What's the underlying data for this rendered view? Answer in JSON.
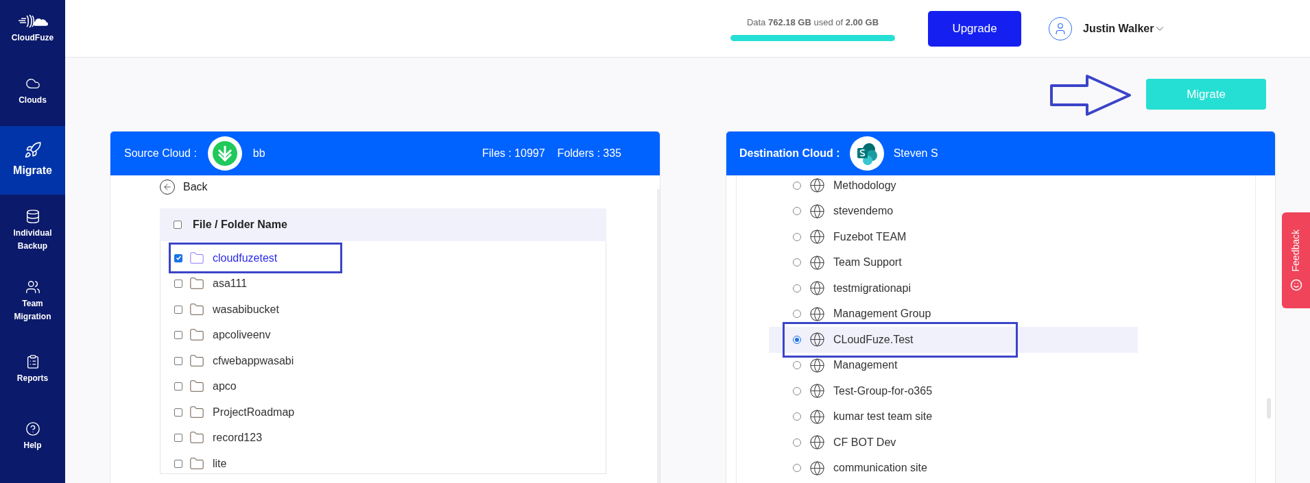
{
  "sidebar": {
    "brand": "CloudFuze",
    "items": [
      {
        "label": "Clouds",
        "selected": false
      },
      {
        "label": "Migrate",
        "selected": true
      },
      {
        "label": "Individual Backup",
        "selected": false
      },
      {
        "label": "Team Migration",
        "selected": false
      },
      {
        "label": "Reports",
        "selected": false
      },
      {
        "label": "Help",
        "selected": false
      }
    ]
  },
  "top_bar": {
    "storage": {
      "text": "Data **762.18 GB** used of **2.00 GB**",
      "level": 1
    },
    "upgrade_button": "Upgrade",
    "user": "Justin Walker"
  },
  "migrate_button": "Migrate",
  "source": {
    "label": "Source Cloud :",
    "account": "bb",
    "files": "Files : 10997",
    "folders": "Folders : 335",
    "back": "Back",
    "column": "File / Folder Name",
    "all_checked": false,
    "rows": [
      {
        "name": "cloudfuzetest",
        "checked": true
      },
      {
        "name": "asa111",
        "checked": false
      },
      {
        "name": "wasabibucket",
        "checked": false
      },
      {
        "name": "apcoliveenv",
        "checked": false
      },
      {
        "name": "cfwebappwasabi",
        "checked": false
      },
      {
        "name": "apco",
        "checked": false
      },
      {
        "name": "ProjectRoadmap",
        "checked": false
      },
      {
        "name": "record123",
        "checked": false
      },
      {
        "name": "lite",
        "checked": false
      }
    ]
  },
  "destination": {
    "label": "Destination Cloud :",
    "account": "Steven S",
    "sites": [
      {
        "name": "Methodology",
        "selected": false
      },
      {
        "name": "stevendemo",
        "selected": false
      },
      {
        "name": "Fuzebot TEAM",
        "selected": false
      },
      {
        "name": "Team Support",
        "selected": false
      },
      {
        "name": "testmigrationapi",
        "selected": false
      },
      {
        "name": "Management Group",
        "selected": false
      },
      {
        "name": "CLoudFuze.Test",
        "selected": true
      },
      {
        "name": "Management",
        "selected": false
      },
      {
        "name": "Test-Group-for-o365",
        "selected": false
      },
      {
        "name": "kumar test team site",
        "selected": false
      },
      {
        "name": "CF BOT Dev",
        "selected": false
      },
      {
        "name": "communication site",
        "selected": false
      }
    ]
  },
  "feedback": "Feedback"
}
